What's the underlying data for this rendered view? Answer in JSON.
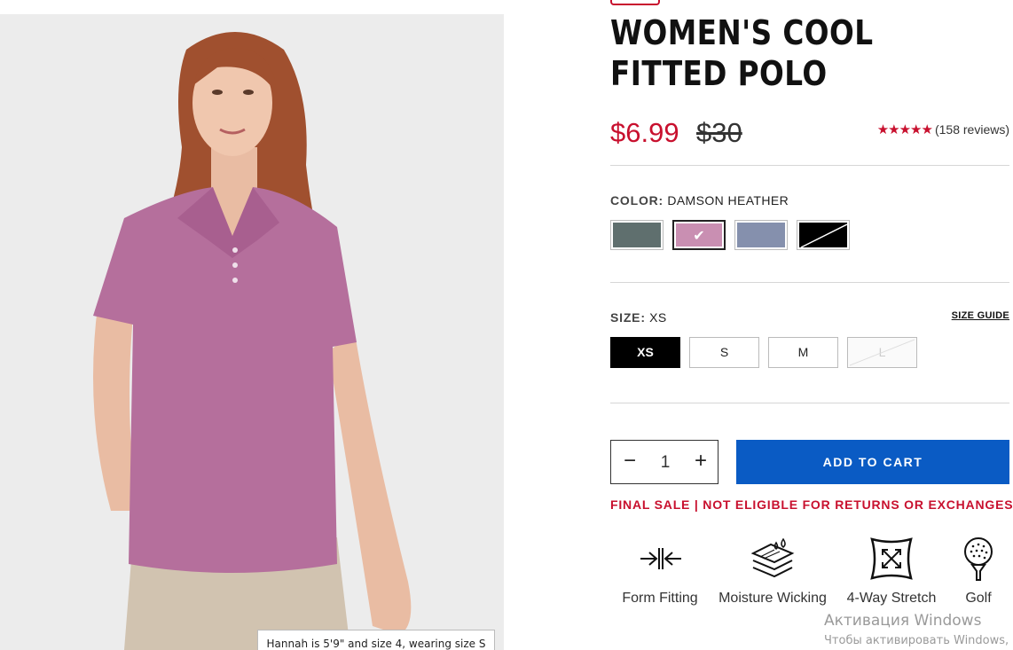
{
  "product": {
    "title": "WOMEN'S COOL FITTED POLO",
    "price_sale": "$6.99",
    "price_original": "$30",
    "rating_stars": "★★★★★",
    "rating_value": 5,
    "reviews": "(158 reviews)"
  },
  "image": {
    "caption": "Hannah is 5'9\" and size 4, wearing size S"
  },
  "color": {
    "label": "COLOR:",
    "selected": "DAMSON HEATHER",
    "swatches": [
      {
        "name": "slate green",
        "hex": "#5f6f6e",
        "selected": false,
        "available": true
      },
      {
        "name": "damson heather",
        "hex": "#c98fb2",
        "selected": true,
        "available": true
      },
      {
        "name": "blue grey",
        "hex": "#8590ad",
        "selected": false,
        "available": true
      },
      {
        "name": "black",
        "hex": "#000000",
        "selected": false,
        "available": false
      }
    ]
  },
  "size": {
    "label": "SIZE:",
    "selected": "XS",
    "guide": "SIZE GUIDE",
    "options": [
      "XS",
      "S",
      "M",
      "L"
    ]
  },
  "cart": {
    "quantity": "1",
    "minus": "−",
    "plus": "+",
    "add_label": "ADD TO CART",
    "notice": "FINAL SALE | NOT ELIGIBLE FOR RETURNS OR EXCHANGES"
  },
  "features": [
    {
      "label": "Form Fitting",
      "icon": "form-fitting-icon"
    },
    {
      "label": "Moisture Wicking",
      "icon": "moisture-wicking-icon"
    },
    {
      "label": "4-Way Stretch",
      "icon": "four-way-stretch-icon"
    },
    {
      "label": "Golf",
      "icon": "golf-icon"
    }
  ],
  "os_watermark": {
    "line1": "Активация Windows",
    "line2": "Чтобы активировать Windows,"
  },
  "colors": {
    "accent_red": "#c8102e",
    "cart_blue": "#0a5bc4",
    "polo": "#b56f9c"
  }
}
